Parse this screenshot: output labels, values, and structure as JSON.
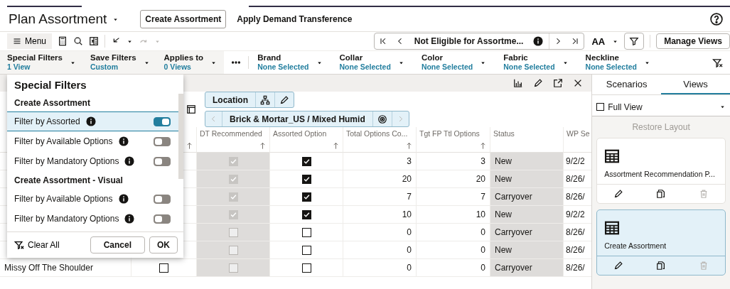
{
  "header": {
    "title": "Plan Assortment",
    "tabs": [
      {
        "label": "Create Assortment",
        "selected": true
      },
      {
        "label": "Apply Demand Transference",
        "selected": false
      }
    ]
  },
  "toolbar": {
    "menu_label": "Menu",
    "navigator_label": "Not Eligible for Assortme...",
    "text_size_label": "AA",
    "manage_views_label": "Manage Views"
  },
  "filter_groups": [
    {
      "label": "Special Filters",
      "value": "1 View"
    },
    {
      "label": "Save Filters",
      "value": "Custom"
    },
    {
      "label": "Applies to",
      "value": "0 Views"
    }
  ],
  "attribute_filters": [
    {
      "label": "Brand",
      "value": "None Selected"
    },
    {
      "label": "Collar",
      "value": "None Selected"
    },
    {
      "label": "Color",
      "value": "None Selected"
    },
    {
      "label": "Fabric",
      "value": "None Selected"
    },
    {
      "label": "Neckline",
      "value": "None Selected"
    }
  ],
  "grid": {
    "location_label": "Location",
    "breadcrumb": "Brick & Mortar_US / Mixed Humid",
    "columns": [
      {
        "label": "DT Recommended",
        "readonly": true
      },
      {
        "label": "Assorted Option",
        "readonly": false
      },
      {
        "label": "Total Options Co...",
        "readonly": false
      },
      {
        "label": "Tgt FP Ttl Options",
        "readonly": false
      },
      {
        "label": "Status",
        "readonly": true
      },
      {
        "label": "WP Se",
        "readonly": false
      }
    ],
    "rows": [
      {
        "dt_recommended": true,
        "assorted": true,
        "total_options": "3",
        "tgt_options": "3",
        "status": "New",
        "wp": "9/2/2"
      },
      {
        "dt_recommended": true,
        "assorted": true,
        "total_options": "20",
        "tgt_options": "20",
        "status": "New",
        "wp": "8/26/"
      },
      {
        "dt_recommended": true,
        "assorted": true,
        "total_options": "7",
        "tgt_options": "7",
        "status": "Carryover",
        "wp": "8/26/"
      },
      {
        "dt_recommended": true,
        "assorted": true,
        "total_options": "10",
        "tgt_options": "10",
        "status": "New",
        "wp": "9/2/2"
      },
      {
        "dt_recommended": false,
        "assorted": false,
        "total_options": "0",
        "tgt_options": "0",
        "status": "Carryover",
        "wp": "8/26/"
      },
      {
        "dt_recommended": false,
        "assorted": false,
        "total_options": "0",
        "tgt_options": "0",
        "status": "New",
        "wp": "8/26/"
      },
      {
        "name": "Missy Off The Shoulder",
        "column_2_checked": false,
        "dt_recommended": false,
        "assorted": false,
        "total_options": "0",
        "tgt_options": "0",
        "status": "Carryover",
        "wp": "8/26/"
      }
    ]
  },
  "special_filters": {
    "title": "Special Filters",
    "sections": [
      {
        "title": "Create Assortment",
        "items": [
          {
            "label": "Filter by Assorted",
            "selected": true,
            "on": true
          },
          {
            "label": "Filter by Available Options",
            "selected": false,
            "on": false
          },
          {
            "label": "Filter by Mandatory Options",
            "selected": false,
            "on": false
          }
        ]
      },
      {
        "title": "Create Assortment - Visual",
        "items": [
          {
            "label": "Filter by Available Options",
            "selected": false,
            "on": false
          },
          {
            "label": "Filter by Mandatory Options",
            "selected": false,
            "on": false
          }
        ]
      }
    ],
    "clear_label": "Clear All",
    "cancel_label": "Cancel",
    "ok_label": "OK"
  },
  "side_panel": {
    "tabs": [
      {
        "label": "Scenarios",
        "selected": false
      },
      {
        "label": "Views",
        "selected": true
      }
    ],
    "view_select": {
      "label": "Full View",
      "checked": false
    },
    "restore_label": "Restore Layout",
    "views": [
      {
        "name": "Assortment Recommendation P...",
        "selected": false
      },
      {
        "name": "Create Assortment",
        "selected": true
      }
    ]
  }
}
